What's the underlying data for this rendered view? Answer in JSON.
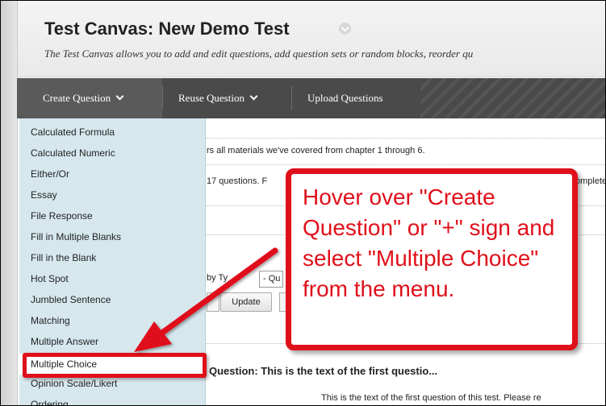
{
  "header": {
    "title": "Test Canvas: New Demo Test",
    "subtitle": "The Test Canvas allows you to add and edit questions, add question sets or random blocks, reorder qu"
  },
  "toolbar": {
    "create_question": "Create Question",
    "reuse_question": "Reuse Question",
    "upload_questions": "Upload Questions"
  },
  "menu": {
    "items": [
      {
        "label": "Calculated Formula"
      },
      {
        "label": "Calculated Numeric"
      },
      {
        "label": "Either/Or"
      },
      {
        "label": "Essay"
      },
      {
        "label": "File Response"
      },
      {
        "label": "Fill in Multiple Blanks"
      },
      {
        "label": "Fill in the Blank"
      },
      {
        "label": "Hot Spot"
      },
      {
        "label": "Jumbled Sentence"
      },
      {
        "label": "Matching"
      },
      {
        "label": "Multiple Answer"
      },
      {
        "label": "Multiple Choice"
      },
      {
        "label": "Opinion Scale/Likert"
      },
      {
        "label": "Ordering"
      }
    ],
    "highlighted": "Multiple Choice"
  },
  "content": {
    "line1": "rs all materials we've covered from chapter 1 through 6.",
    "line2": "17 questions. F",
    "line2_right": "omplete",
    "filter_label": "by Ty",
    "filter_select": "- Qu",
    "update_button": "Update",
    "question_heading": "Question: This is the text of the first questio...",
    "question_body": "This is the text of the first question of this test. Please re"
  },
  "callout": {
    "text": "Hover over \"Create Question\" or \"+\" sign and select \"Multiple Choice\" from the menu."
  },
  "colors": {
    "accent": "#e0101a",
    "toolbar": "#4a4a4a",
    "menu_bg": "#d6e8ee"
  },
  "icons": [
    "chevron-down-icon",
    "arrow-icon"
  ]
}
